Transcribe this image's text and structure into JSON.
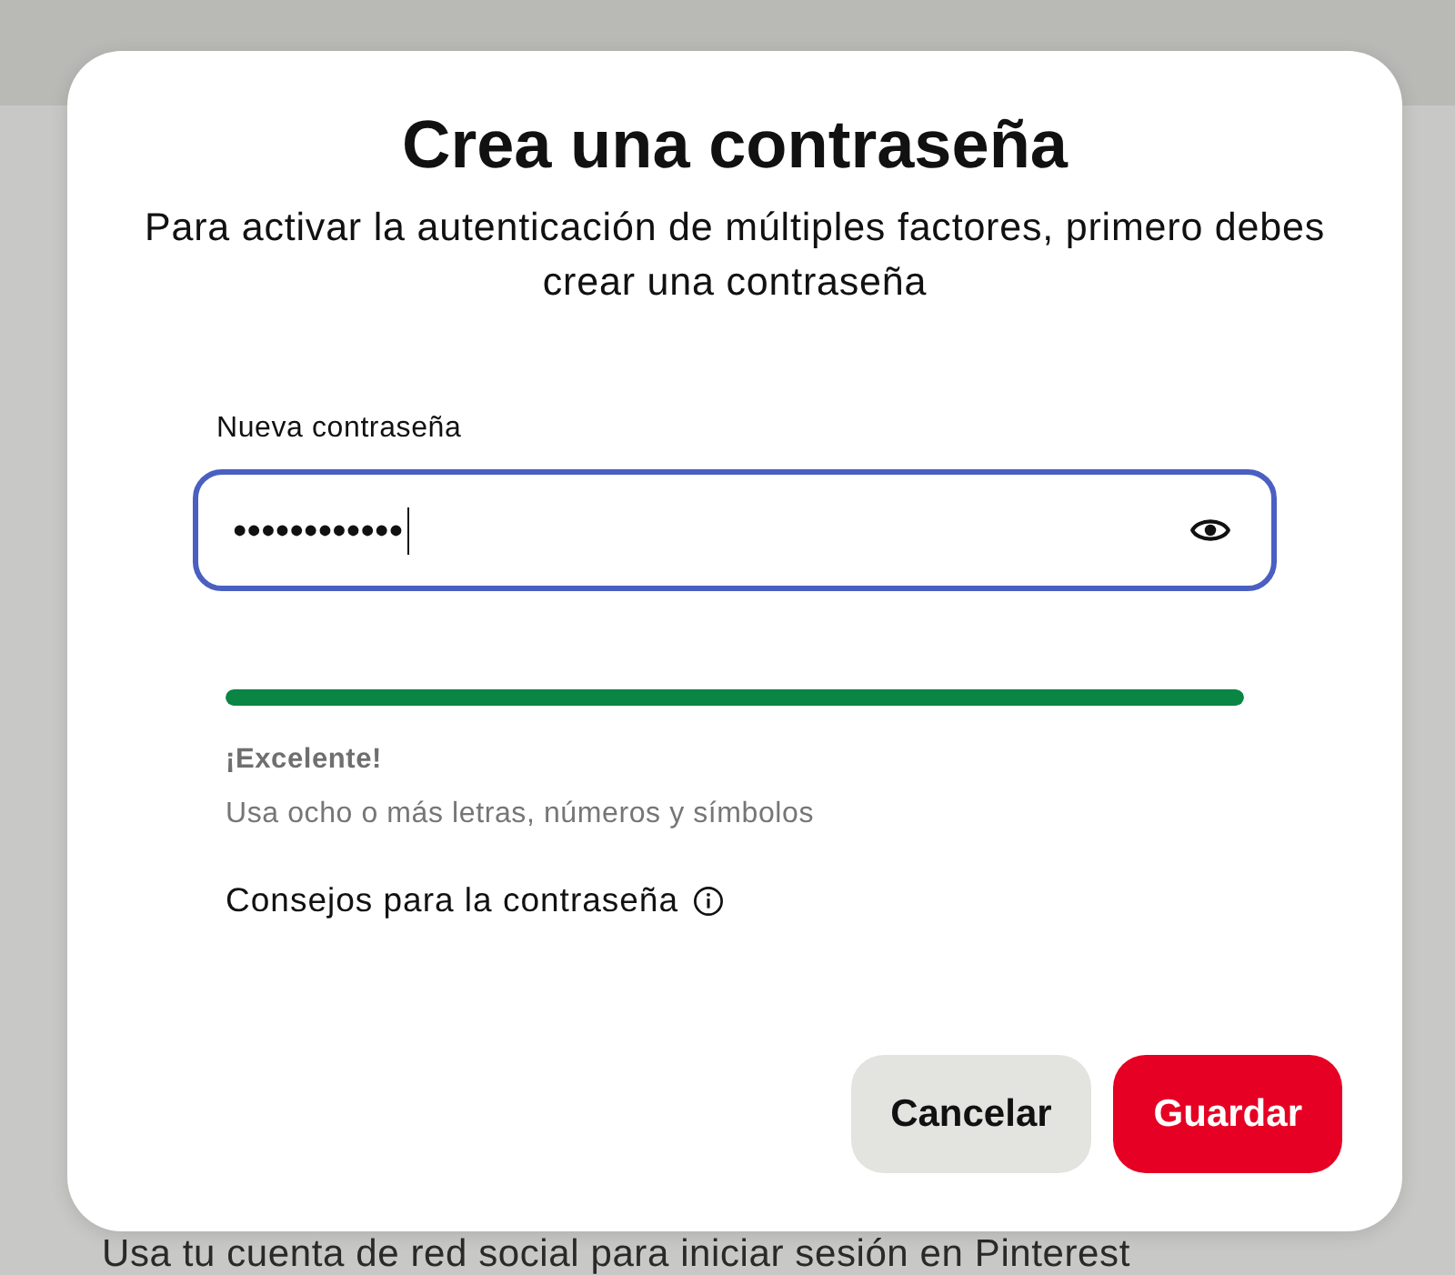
{
  "dialog": {
    "title": "Crea una contraseña",
    "subtitle": "Para activar la autenticación de múltiples factores, primero debes crear una contraseña"
  },
  "password_field": {
    "label": "Nueva contraseña",
    "value": "••••••••••••",
    "focused": true
  },
  "strength": {
    "level": 1,
    "rating": "¡Excelente!",
    "hint": "Usa ocho o más letras, números y símbolos"
  },
  "tips_link": "Consejos para la contraseña",
  "buttons": [
    {
      "label": "Cancelar",
      "kind": "secondary"
    },
    {
      "label": "Guardar",
      "kind": "primary"
    }
  ],
  "background_page": {
    "text": "Usa tu cuenta de red social para iniciar sesión en Pinterest"
  }
}
